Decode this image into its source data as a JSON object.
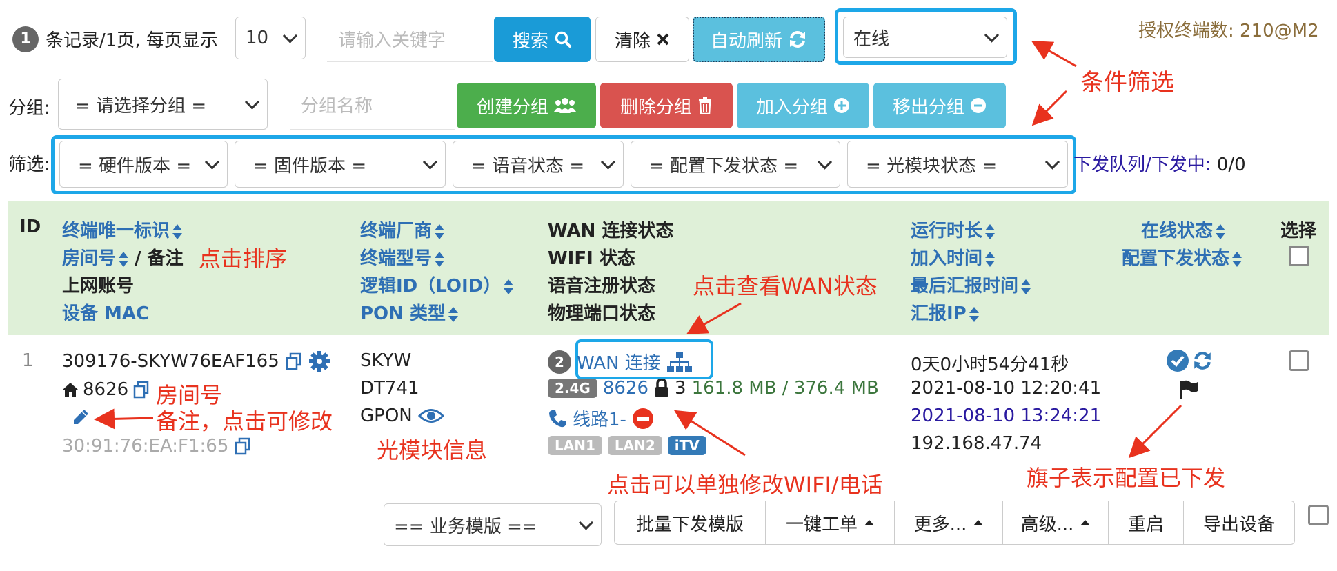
{
  "toolbar": {
    "record_count": "1",
    "record_text": "条记录/1页, 每页显示",
    "page_size": "10",
    "keyword_placeholder": "请输入关键字",
    "search_label": "搜索",
    "clear_label": "清除",
    "autorefresh_label": "自动刷新",
    "status_filter": "在线",
    "license_text": "授权终端数: 210@M2"
  },
  "group_row": {
    "label": "分组:",
    "group_select": "= 请选择分组 =",
    "group_name_placeholder": "分组名称",
    "create_label": "创建分组",
    "delete_label": "删除分组",
    "join_label": "加入分组",
    "remove_label": "移出分组"
  },
  "filter_row": {
    "label": "筛选:",
    "hardware": "= 硬件版本 =",
    "firmware": "= 固件版本 =",
    "voice": "= 语音状态 =",
    "config": "= 配置下发状态 =",
    "optical": "= 光模块状态 =",
    "queue_label": "下发队列/下发中:",
    "queue_value": "0/0"
  },
  "table": {
    "headers": {
      "id": "ID",
      "col1": [
        "终端唯一标识",
        "房间号",
        "/ 备注",
        "上网账号",
        "设备 MAC"
      ],
      "col2": [
        "终端厂商",
        "终端型号",
        "逻辑ID（LOID）",
        "PON 类型"
      ],
      "col3": [
        "WAN 连接状态",
        "WIFI 状态",
        "语音注册状态",
        "物理端口状态"
      ],
      "col4": [
        "运行时长",
        "加入时间",
        "最后汇报时间",
        "汇报IP"
      ],
      "col5": [
        "在线状态",
        "配置下发状态"
      ],
      "select": "选择"
    },
    "row": {
      "id": "1",
      "device_id": "309176-SKYW76EAF165",
      "room": "8626",
      "mac": "30:91:76:EA:F1:65",
      "vendor": "SKYW",
      "model": "DT741",
      "pon": "GPON",
      "wan_count": "2",
      "wan_label": "WAN 连接",
      "band": "2.4G",
      "ssid": "8626",
      "clients": "3",
      "traffic": "161.8 MB / 376.4 MB",
      "line_label": "线路1-",
      "ports": [
        "LAN1",
        "LAN2",
        "iTV"
      ],
      "uptime": "0天0小时54分41秒",
      "join_time": "2021-08-10 12:20:41",
      "report_time": "2021-08-10 13:24:21",
      "report_ip": "192.168.47.74"
    }
  },
  "annotations": {
    "filter": "条件筛选",
    "sort": "点击排序",
    "wan": "点击查看WAN状态",
    "room": "房间号",
    "note": "备注，点击可修改",
    "optical": "光模块信息",
    "wifi": "点击可以单独修改WIFI/电话",
    "flag": "旗子表示配置已下发"
  },
  "bottom": {
    "template_select": "== 业务模版 ==",
    "batch_label": "批量下发模版",
    "ticket_label": "一键工单",
    "more_label": "更多...",
    "advanced_label": "高级...",
    "reboot_label": "重启",
    "export_label": "导出设备"
  },
  "colors": {
    "primary": "#1a9bd7",
    "success": "#4cae4c",
    "danger": "#d9534f",
    "info": "#5bc0de",
    "highlight": "#1da7e8",
    "annotation": "#e8321e",
    "header_bg": "#dff0d8",
    "link": "#2e6fb4"
  }
}
